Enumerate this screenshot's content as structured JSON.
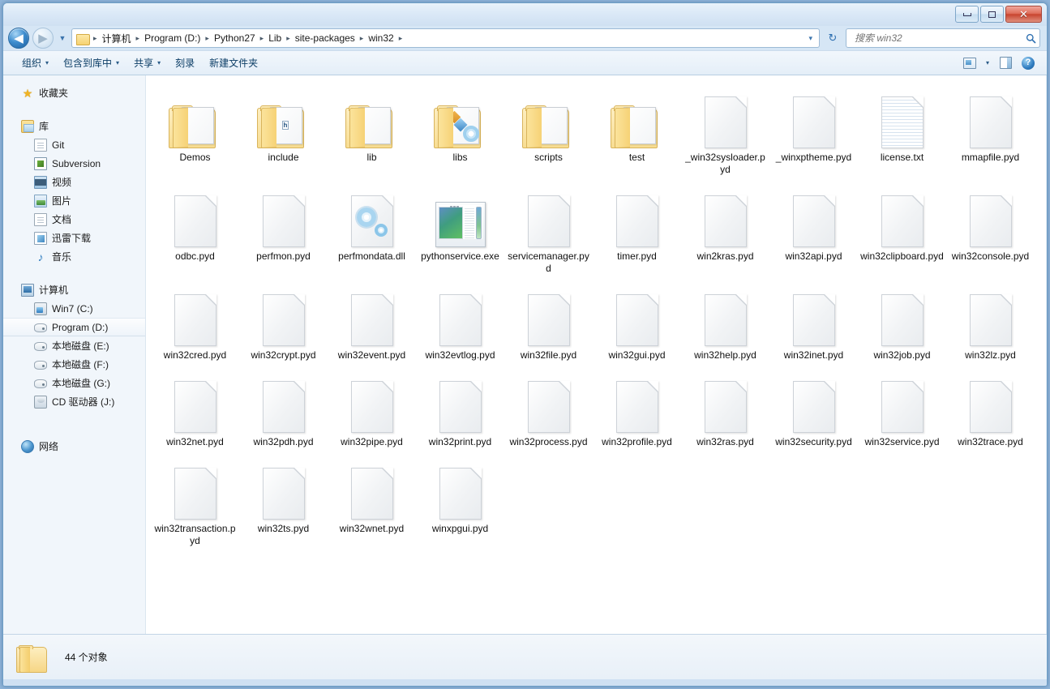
{
  "window": {
    "controls": {
      "minimize": "Minimize",
      "maximize": "Maximize",
      "close": "✕"
    }
  },
  "address_bar": {
    "back_glyph": "◀",
    "forward_glyph": "▶",
    "history_caret": "▼",
    "breadcrumbs": [
      "计算机",
      "Program (D:)",
      "Python27",
      "Lib",
      "site-packages",
      "win32"
    ],
    "separator": "▸",
    "dropdown_caret": "▾",
    "refresh_glyph": "↻"
  },
  "search": {
    "placeholder": "搜索 win32",
    "icon": "search-icon",
    "value": ""
  },
  "toolbar": {
    "items": [
      {
        "label": "组织",
        "caret": "▾"
      },
      {
        "label": "包含到库中",
        "caret": "▾"
      },
      {
        "label": "共享",
        "caret": "▾"
      },
      {
        "label": "刻录",
        "caret": ""
      },
      {
        "label": "新建文件夹",
        "caret": ""
      }
    ],
    "right_icons": [
      {
        "name": "view-mode-icon",
        "caret": "▾"
      },
      {
        "name": "preview-pane-icon",
        "caret": ""
      },
      {
        "name": "help-icon",
        "glyph": "?"
      }
    ]
  },
  "sidebar": {
    "groups": [
      {
        "header": {
          "label": "收藏夹",
          "icon": "star-icon"
        },
        "children": []
      },
      {
        "header": {
          "label": "库",
          "icon": "library-icon"
        },
        "children": [
          {
            "label": "Git",
            "icon": "git-icon"
          },
          {
            "label": "Subversion",
            "icon": "subversion-icon"
          },
          {
            "label": "视频",
            "icon": "video-icon"
          },
          {
            "label": "图片",
            "icon": "pictures-icon"
          },
          {
            "label": "文档",
            "icon": "documents-icon"
          },
          {
            "label": "迅雷下载",
            "icon": "download-icon"
          },
          {
            "label": "音乐",
            "icon": "music-icon"
          }
        ]
      },
      {
        "header": {
          "label": "计算机",
          "icon": "computer-icon"
        },
        "children": [
          {
            "label": "Win7 (C:)",
            "icon": "system-drive-icon",
            "selected": false
          },
          {
            "label": "Program (D:)",
            "icon": "hard-drive-icon",
            "selected": true
          },
          {
            "label": "本地磁盘 (E:)",
            "icon": "hard-drive-icon",
            "selected": false
          },
          {
            "label": "本地磁盘 (F:)",
            "icon": "hard-drive-icon",
            "selected": false
          },
          {
            "label": "本地磁盘 (G:)",
            "icon": "hard-drive-icon",
            "selected": false
          },
          {
            "label": "CD 驱动器 (J:)",
            "icon": "cd-drive-icon",
            "selected": false
          }
        ]
      },
      {
        "header": {
          "label": "网络",
          "icon": "network-icon"
        },
        "children": []
      }
    ]
  },
  "files": [
    {
      "name": "Demos",
      "type": "folder",
      "variant": "plain"
    },
    {
      "name": "include",
      "type": "folder",
      "variant": "h-badge"
    },
    {
      "name": "lib",
      "type": "folder",
      "variant": "plain"
    },
    {
      "name": "libs",
      "type": "folder",
      "variant": "art"
    },
    {
      "name": "scripts",
      "type": "folder",
      "variant": "plain"
    },
    {
      "name": "test",
      "type": "folder",
      "variant": "plain"
    },
    {
      "name": "_win32sysloader.pyd",
      "type": "file",
      "variant": "blank"
    },
    {
      "name": "_winxptheme.pyd",
      "type": "file",
      "variant": "blank"
    },
    {
      "name": "license.txt",
      "type": "file",
      "variant": "txt"
    },
    {
      "name": "mmapfile.pyd",
      "type": "file",
      "variant": "blank"
    },
    {
      "name": "odbc.pyd",
      "type": "file",
      "variant": "blank"
    },
    {
      "name": "perfmon.pyd",
      "type": "file",
      "variant": "blank"
    },
    {
      "name": "perfmondata.dll",
      "type": "file",
      "variant": "dll"
    },
    {
      "name": "pythonservice.exe",
      "type": "file",
      "variant": "exe"
    },
    {
      "name": "servicemanager.pyd",
      "type": "file",
      "variant": "blank"
    },
    {
      "name": "timer.pyd",
      "type": "file",
      "variant": "blank"
    },
    {
      "name": "win2kras.pyd",
      "type": "file",
      "variant": "blank"
    },
    {
      "name": "win32api.pyd",
      "type": "file",
      "variant": "blank"
    },
    {
      "name": "win32clipboard.pyd",
      "type": "file",
      "variant": "blank"
    },
    {
      "name": "win32console.pyd",
      "type": "file",
      "variant": "blank"
    },
    {
      "name": "win32cred.pyd",
      "type": "file",
      "variant": "blank"
    },
    {
      "name": "win32crypt.pyd",
      "type": "file",
      "variant": "blank"
    },
    {
      "name": "win32event.pyd",
      "type": "file",
      "variant": "blank"
    },
    {
      "name": "win32evtlog.pyd",
      "type": "file",
      "variant": "blank"
    },
    {
      "name": "win32file.pyd",
      "type": "file",
      "variant": "blank"
    },
    {
      "name": "win32gui.pyd",
      "type": "file",
      "variant": "blank"
    },
    {
      "name": "win32help.pyd",
      "type": "file",
      "variant": "blank"
    },
    {
      "name": "win32inet.pyd",
      "type": "file",
      "variant": "blank"
    },
    {
      "name": "win32job.pyd",
      "type": "file",
      "variant": "blank"
    },
    {
      "name": "win32lz.pyd",
      "type": "file",
      "variant": "blank"
    },
    {
      "name": "win32net.pyd",
      "type": "file",
      "variant": "blank"
    },
    {
      "name": "win32pdh.pyd",
      "type": "file",
      "variant": "blank"
    },
    {
      "name": "win32pipe.pyd",
      "type": "file",
      "variant": "blank"
    },
    {
      "name": "win32print.pyd",
      "type": "file",
      "variant": "blank"
    },
    {
      "name": "win32process.pyd",
      "type": "file",
      "variant": "blank"
    },
    {
      "name": "win32profile.pyd",
      "type": "file",
      "variant": "blank"
    },
    {
      "name": "win32ras.pyd",
      "type": "file",
      "variant": "blank"
    },
    {
      "name": "win32security.pyd",
      "type": "file",
      "variant": "blank"
    },
    {
      "name": "win32service.pyd",
      "type": "file",
      "variant": "blank"
    },
    {
      "name": "win32trace.pyd",
      "type": "file",
      "variant": "blank"
    },
    {
      "name": "win32transaction.pyd",
      "type": "file",
      "variant": "blank"
    },
    {
      "name": "win32ts.pyd",
      "type": "file",
      "variant": "blank"
    },
    {
      "name": "win32wnet.pyd",
      "type": "file",
      "variant": "blank"
    },
    {
      "name": "winxpgui.pyd",
      "type": "file",
      "variant": "blank"
    }
  ],
  "status": {
    "text": "44 个对象",
    "icon": "folder-icon"
  },
  "colors": {
    "frame": "#8fb4d9",
    "titlebar": "#dbe9f7",
    "close_button": "#c8442f",
    "sidebar_bg": "#f1f6fb",
    "pane_bg": "#ffffff",
    "folder_yellow": "#f6d272"
  }
}
